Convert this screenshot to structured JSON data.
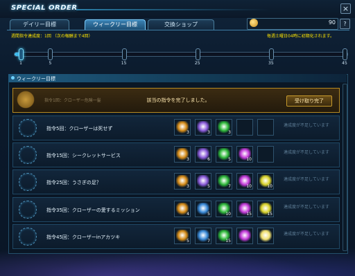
{
  "window": {
    "title": "SPECIAL ORDER",
    "close_label": "×",
    "help_label": "?"
  },
  "tabs": [
    {
      "label": "デイリー目標"
    },
    {
      "label": "ウィークリー目標"
    },
    {
      "label": "交換ショップ"
    }
  ],
  "currency": {
    "value": "90"
  },
  "progress": {
    "text": "週間指令達成度：1回 （次の報酬まで4回）",
    "reset_text": "毎週土曜日04時に初期化されます。",
    "current": 1,
    "max": 45,
    "milestones": [
      1,
      5,
      15,
      25,
      35,
      45
    ],
    "tick_labels": [
      "1",
      "5",
      "15",
      "25",
      "35",
      "45"
    ]
  },
  "section": {
    "title": "ウィークリー目標"
  },
  "featured": {
    "label": "指令1回：クローザー危険一髪",
    "message": "該当の指令を完了しました。",
    "button": "受け取り完了"
  },
  "orders": [
    {
      "label": "指令5回：クローザーは死せず",
      "status": "達成度が不足しています",
      "rewards": [
        {
          "icon": "gold-item-icon",
          "count": "3",
          "color": "#d48a16"
        },
        {
          "icon": "rainbow-crystal-icon",
          "count": "3",
          "color": "#8a5ad8"
        },
        {
          "icon": "green-star-icon",
          "count": "3",
          "color": "#2fb83a"
        }
      ]
    },
    {
      "label": "指令15回：シークレットサービス",
      "status": "達成度が不足しています",
      "rewards": [
        {
          "icon": "gold-item-icon",
          "count": "3",
          "color": "#d48a16"
        },
        {
          "icon": "rainbow-crystal-icon",
          "count": "6",
          "color": "#8a5ad8"
        },
        {
          "icon": "green-star-icon",
          "count": "5",
          "color": "#2fb83a"
        },
        {
          "icon": "purple-burst-icon",
          "count": "10",
          "color": "#c23ad8"
        }
      ]
    },
    {
      "label": "指令25回：うさぎの足？",
      "status": "達成度が不足しています",
      "rewards": [
        {
          "icon": "gold-item-icon",
          "count": "3",
          "color": "#d48a16"
        },
        {
          "icon": "rainbow-crystal-icon",
          "count": "5",
          "color": "#8a5ad8"
        },
        {
          "icon": "green-star-icon",
          "count": "7",
          "color": "#2fb83a"
        },
        {
          "icon": "purple-burst-icon",
          "count": "10",
          "color": "#c23ad8"
        },
        {
          "icon": "yellow-burst-icon",
          "count": "10",
          "color": "#d8d22a"
        }
      ]
    },
    {
      "label": "指令35回：クローザーの愛するミッション",
      "status": "達成度が不足しています",
      "rewards": [
        {
          "icon": "gold-item-icon",
          "count": "4",
          "color": "#d48a16"
        },
        {
          "icon": "rainbow-crystal-icon",
          "count": "5",
          "color": "#3a8ad8"
        },
        {
          "icon": "green-star-icon",
          "count": "10",
          "color": "#2fb83a"
        },
        {
          "icon": "purple-burst-icon",
          "count": "15",
          "color": "#c23ad8"
        },
        {
          "icon": "yellow-burst-icon",
          "count": "15",
          "color": "#d8d22a"
        }
      ]
    },
    {
      "label": "指令45回：クローザーinアカツキ",
      "status": "達成度が不足しています",
      "rewards": [
        {
          "icon": "gold-item-icon",
          "count": "5",
          "color": "#d48a16"
        },
        {
          "icon": "rainbow-crystal-icon",
          "count": "7",
          "color": "#3a8ad8"
        },
        {
          "icon": "green-star-icon",
          "count": "15",
          "color": "#2fb83a"
        },
        {
          "icon": "purple-burst-icon",
          "count": "",
          "color": "#c23ad8"
        },
        {
          "icon": "white-burst-icon",
          "count": "",
          "color": "#f0e070"
        }
      ]
    }
  ],
  "colors": {
    "accent": "#4cd0ff",
    "progress_text": "#ffe600",
    "featured_border": "#b88a1f"
  }
}
